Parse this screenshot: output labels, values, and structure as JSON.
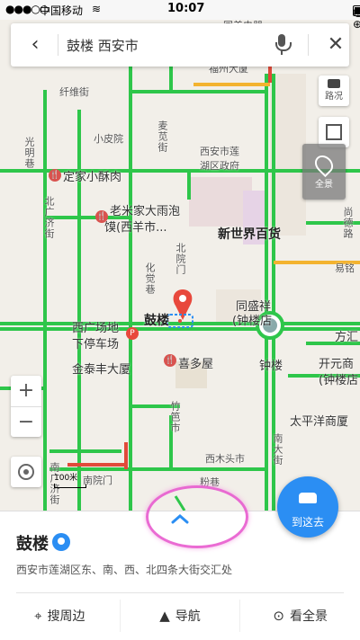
{
  "status_bar": {
    "signal": "●●●○○",
    "carrier": "中国移动",
    "wifi": "≋",
    "time": "10:07",
    "right_icons": "@ ⊕"
  },
  "search": {
    "back": "‹",
    "query": "鼓楼 西安市",
    "close": "✕"
  },
  "map_labels": {
    "xiaopiyuan": "小皮院",
    "gov": "西安市莲\n湖区政府",
    "dingjia": "定家小酥肉",
    "laomijia1": "老米家大雨泡",
    "laomijia2": "馍(西羊市...",
    "newworld": "新世界百货",
    "yige": "易铭",
    "tongshengxiang1": "同盛祥",
    "tongshengxiang2": "(钟楼店",
    "gulou": "鼓楼",
    "xiguang1": "西广场地",
    "xiguang2": "下停车场",
    "jintaifeng": "金泰丰大厦",
    "xiduowu": "喜多屋",
    "zhonglou": "钟楼",
    "fangyuan": "方汇",
    "kaiyuan1": "开元商",
    "kaiyuan2": "(钟楼店",
    "taipingyang": "太平洋商厦",
    "ximutou": "西木头市",
    "fenxiang": "粉巷",
    "nanyuanmen": "南院门",
    "jingweijie": "纤维街",
    "guangming": "光明巷",
    "beiguangji": "北广济街",
    "beiyuanmen": "北院门",
    "huajue": "化觉巷",
    "maijijie": "麦苋街",
    "zhuque": "竹笆市",
    "nanguangji": "南广济街",
    "shangde": "尚德路",
    "nanda": "南大街",
    "luhuang": "路况",
    "quanjing": "全景",
    "top1": "国美电器",
    "top2": "福州大厦"
  },
  "map_controls": {
    "zoom_in": "+",
    "zoom_out": "−",
    "scale": "100米"
  },
  "route_button": {
    "label": "到这去"
  },
  "place": {
    "name": "鼓楼",
    "address": "西安市莲湖区东、南、西、北四条大街交汇处"
  },
  "actions": [
    {
      "icon": "pin-icon",
      "label": "搜周边"
    },
    {
      "icon": "navigate-icon",
      "label": "导航"
    },
    {
      "icon": "panorama-icon",
      "label": "看全景"
    }
  ],
  "colors": {
    "road_green": "#2ec64a",
    "road_red": "#e04a3a",
    "road_yellow": "#f3b32f",
    "accent_blue": "#2b8ef3",
    "marker_red": "#e8483c",
    "annotation_pink": "#e85ccf"
  }
}
